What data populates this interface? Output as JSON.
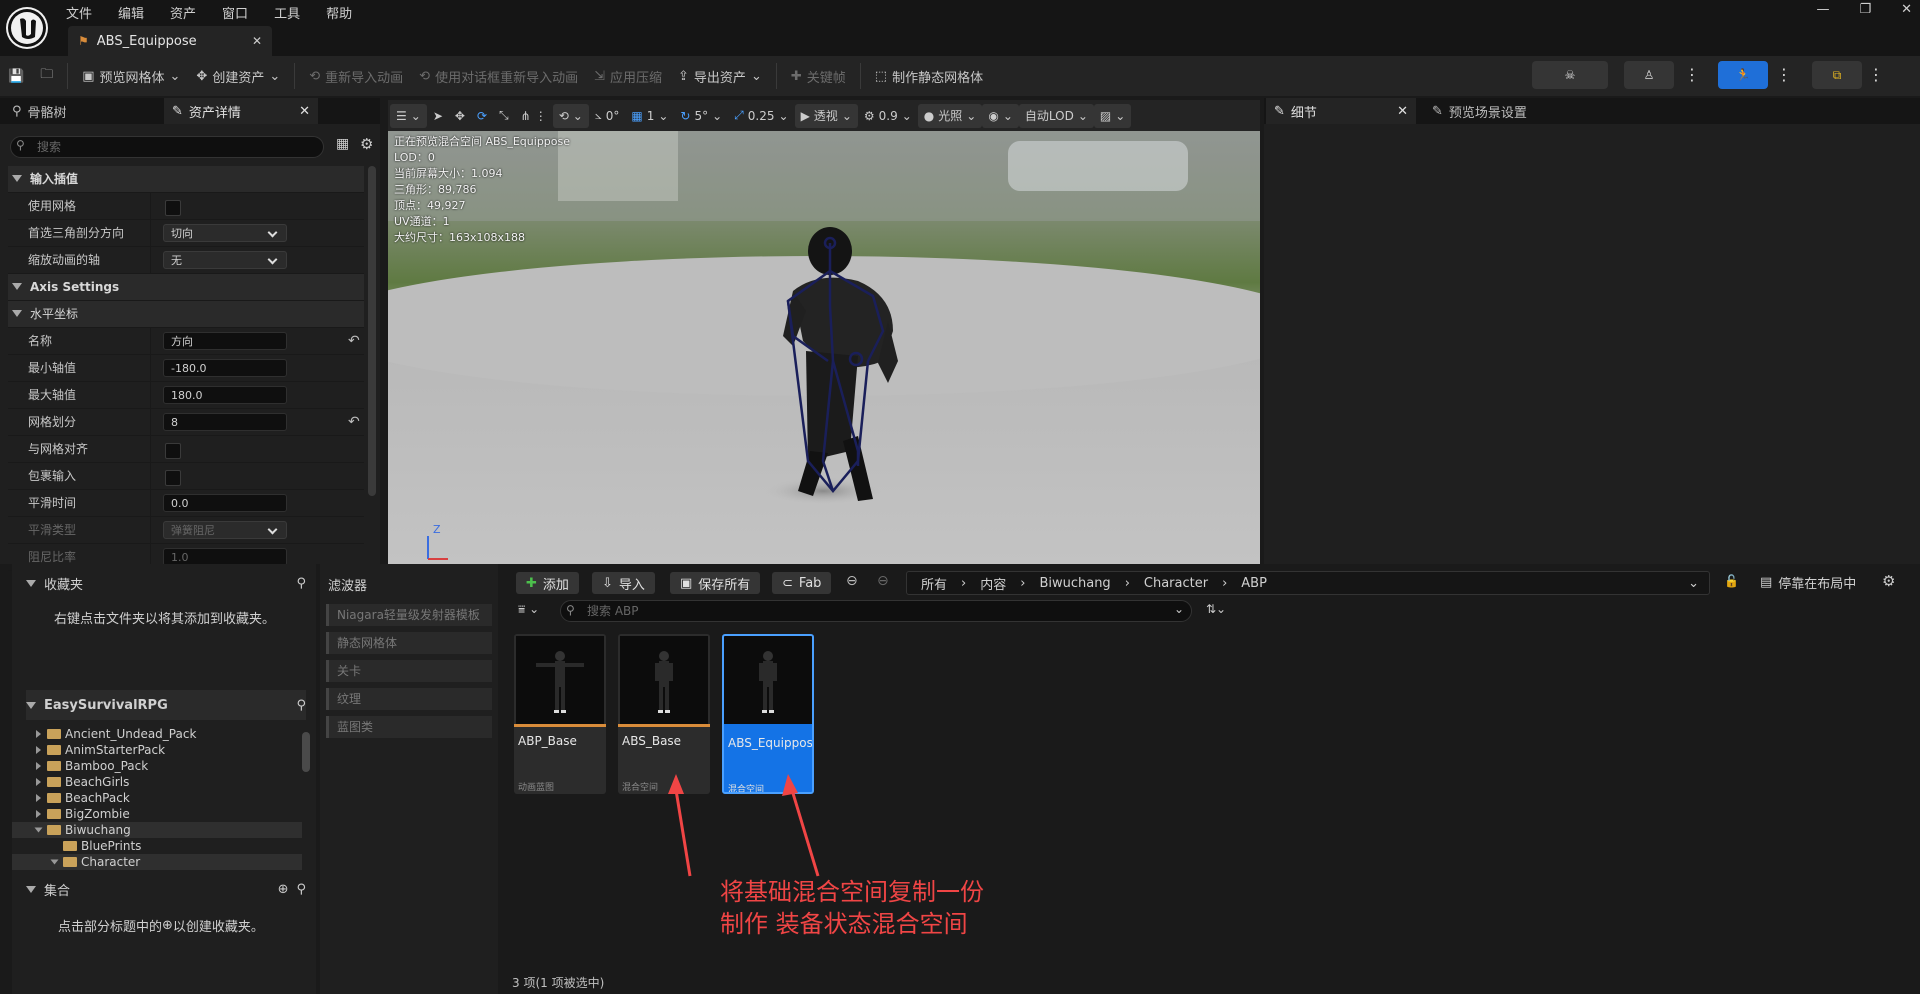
{
  "menu": [
    "文件",
    "编辑",
    "资产",
    "窗口",
    "工具",
    "帮助"
  ],
  "document_tab": {
    "title": "ABS_Equippose"
  },
  "toolbar": {
    "preview_mesh": "预览网格体",
    "create_asset": "创建资产",
    "reimport_anim": "重新导入动画",
    "reimport_dialog": "使用对话框重新导入动画",
    "apply_compression": "应用压缩",
    "export_asset": "导出资产",
    "keyframe": "关键帧",
    "make_static_mesh": "制作静态网格体"
  },
  "left_panel": {
    "tab_skeleton": "骨骼树",
    "tab_asset_details": "资产详情",
    "search_placeholder": "搜索",
    "rows": [
      {
        "label": "输入插值",
        "kind": "category"
      },
      {
        "label": "使用网格",
        "kind": "check"
      },
      {
        "label": "首选三角剖分方向",
        "kind": "combo",
        "value": "切向"
      },
      {
        "label": "缩放动画的轴",
        "kind": "combo",
        "value": "无"
      },
      {
        "label": "Axis Settings",
        "kind": "category"
      },
      {
        "label": "水平坐标",
        "kind": "subcategory"
      },
      {
        "label": "名称",
        "kind": "text",
        "value": "方向"
      },
      {
        "label": "最小轴值",
        "kind": "text",
        "value": "-180.0"
      },
      {
        "label": "最大轴值",
        "kind": "text",
        "value": "180.0"
      },
      {
        "label": "网格划分",
        "kind": "text",
        "value": "8"
      },
      {
        "label": "与网格对齐",
        "kind": "check"
      },
      {
        "label": "包裹输入",
        "kind": "check"
      },
      {
        "label": "平滑时间",
        "kind": "text",
        "value": "0.0"
      },
      {
        "label": "平滑类型",
        "kind": "combo",
        "value": "弹簧阻尼"
      },
      {
        "label": "阻尼比率",
        "kind": "text",
        "value": "1.0"
      }
    ]
  },
  "viewport": {
    "toolbar": {
      "rot": "0°",
      "grid": "1",
      "angle": "5°",
      "scale": "0.25",
      "perspective": "透视",
      "speed": "0.9",
      "lit": "光照",
      "lod": "自动LOD"
    },
    "info": [
      "正在预览混合空间 ABS_Equippose",
      "LOD：0",
      "当前屏幕大小：1.094",
      "三角形：89,786",
      "顶点：49,927",
      "UV通道：1",
      "大约尺寸：163x108x188"
    ],
    "axis_label": "Z"
  },
  "right_panel": {
    "tab_details": "细节",
    "tab_preview_scene": "预览场景设置"
  },
  "content_browser": {
    "favorites": {
      "title": "收藏夹",
      "hint": "右键点击文件夹以将其添加到收藏夹。"
    },
    "project": {
      "title": "EasySurvivalRPG"
    },
    "tree": [
      {
        "name": "Ancient_Undead_Pack",
        "indent": 1,
        "arrow": true
      },
      {
        "name": "AnimStarterPack",
        "indent": 1,
        "arrow": true
      },
      {
        "name": "Bamboo_Pack",
        "indent": 1,
        "arrow": true
      },
      {
        "name": "BeachGirls",
        "indent": 1,
        "arrow": true
      },
      {
        "name": "BeachPack",
        "indent": 1,
        "arrow": true
      },
      {
        "name": "BigZombie",
        "indent": 1,
        "arrow": true
      },
      {
        "name": "Biwuchang",
        "indent": 1,
        "arrow": true,
        "open": true
      },
      {
        "name": "BluePrints",
        "indent": 2,
        "arrow": false
      },
      {
        "name": "Character",
        "indent": 2,
        "arrow": true,
        "open": true
      }
    ],
    "collections": {
      "title": "集合",
      "hint_a": "点击部分标题中的",
      "hint_b": "以创建收藏夹。"
    },
    "filters_title": "滤波器",
    "filters": [
      "Niagara轻量级发射器模板",
      "静态网格体",
      "关卡",
      "纹理",
      "蓝图类"
    ],
    "add": "添加",
    "import": "导入",
    "save_all": "保存所有",
    "fab": "Fab",
    "path": [
      "所有",
      "内容",
      "Biwuchang",
      "Character",
      "ABP"
    ],
    "dock": "停靠在布局中",
    "search_placeholder": "搜索 ABP",
    "assets": [
      {
        "name": "ABP_Base",
        "type": "动画蓝图",
        "selected": false
      },
      {
        "name": "ABS_Base",
        "type": "混合空间",
        "selected": false
      },
      {
        "name": "ABS_Equippose",
        "type": "混合空间",
        "selected": true
      }
    ],
    "status": "3 项(1 项被选中)"
  },
  "annotation": {
    "line1": "将基础混合空间复制一份",
    "line2": "制作 装备状态混合空间"
  },
  "colors": {
    "accent": "#1473e6",
    "annotation": "#f04545",
    "asset_bar": "#d98c3a"
  }
}
